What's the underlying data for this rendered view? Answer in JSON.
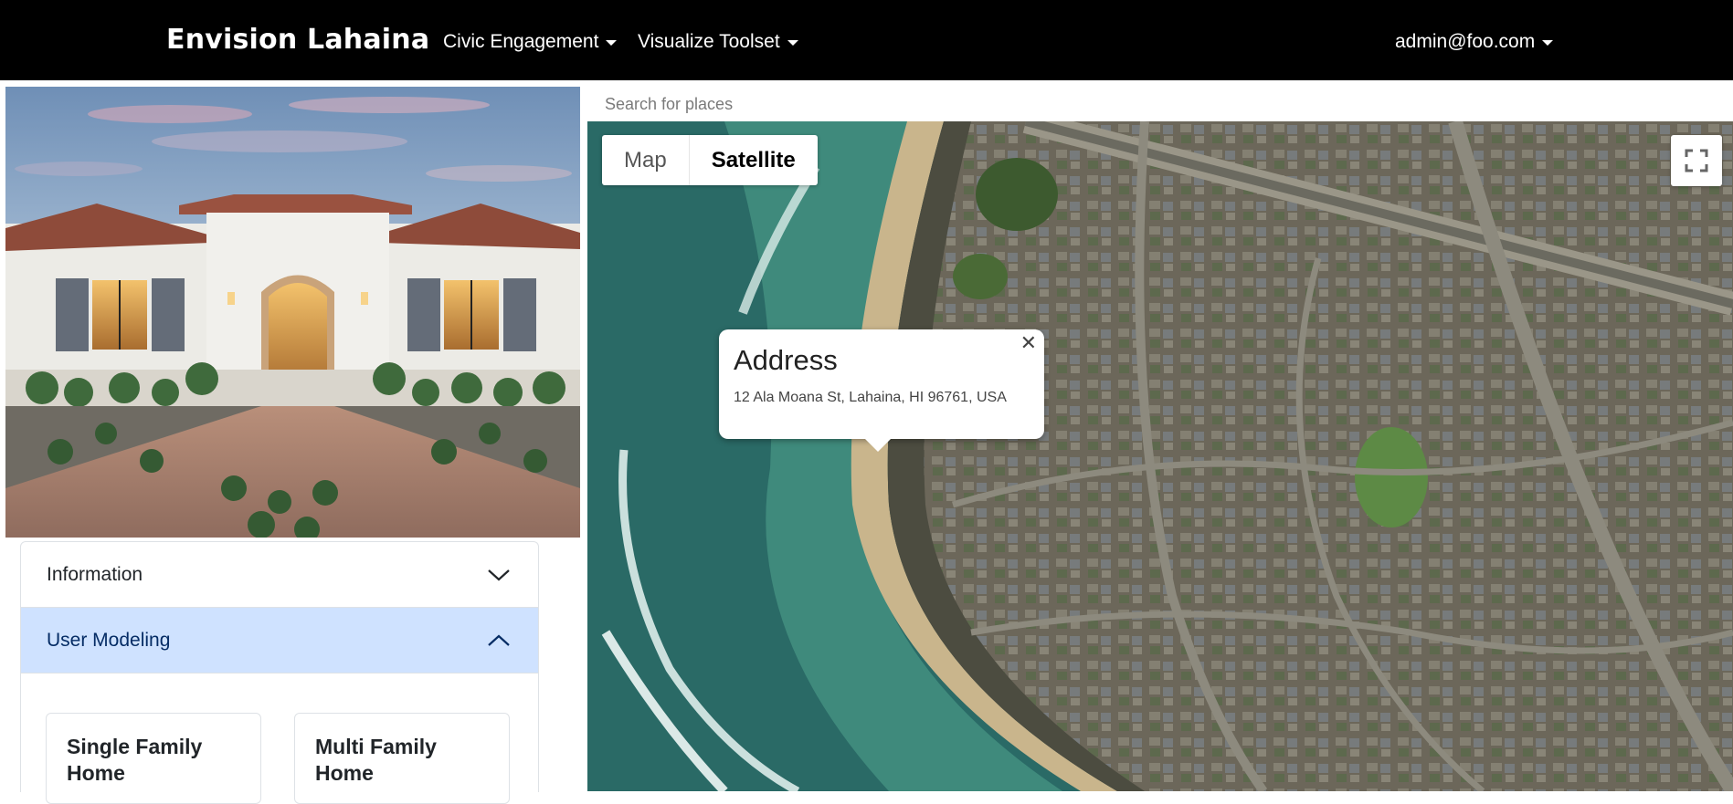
{
  "header": {
    "brand": "Envision Lahaina",
    "nav": [
      {
        "label": "Civic Engagement",
        "icon": "caret-down-icon"
      },
      {
        "label": "Visualize Toolset",
        "icon": "caret-down-icon"
      }
    ],
    "user": {
      "label": "admin@foo.com",
      "icon": "caret-down-icon"
    }
  },
  "accordion": {
    "items": [
      {
        "label": "Information",
        "expanded": false,
        "icon": "chevron-down-icon"
      },
      {
        "label": "User Modeling",
        "expanded": true,
        "icon": "chevron-up-icon"
      }
    ]
  },
  "home_types": [
    {
      "label": "Single Family Home"
    },
    {
      "label": "Multi Family Home"
    }
  ],
  "map": {
    "search_placeholder": "Search for places",
    "map_type": {
      "map_label": "Map",
      "satellite_label": "Satellite",
      "selected": "Satellite"
    },
    "fullscreen_icon": "fullscreen-icon",
    "info_window": {
      "title": "Address",
      "address": "12 Ala Moana St, Lahaina, HI 96761, USA",
      "close_icon": "close-icon"
    }
  },
  "colors": {
    "header_bg": "#000000",
    "accordion_active_bg": "#cfe2ff",
    "accordion_active_text": "#052c65"
  }
}
